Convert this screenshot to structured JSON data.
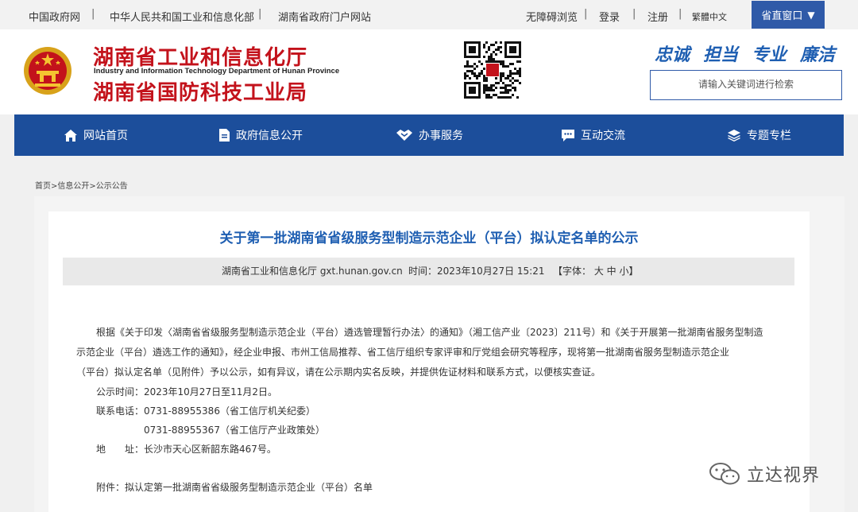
{
  "topbar": {
    "links": [
      "中国政府网",
      "中华人民共和国工业和信息化部",
      "湖南省政府门户网站"
    ],
    "accessibility": "无障碍浏览",
    "login": "登录",
    "register": "注册",
    "traditional": "繁體中文",
    "province_window": "省直窗口"
  },
  "header": {
    "org_name_1": "湖南省工业和信息化厅",
    "org_name_en": "Industry and Information Technology Department of Hunan Province",
    "org_name_2": "湖南省国防科技工业局",
    "slogans": [
      "忠诚",
      "担当",
      "专业",
      "廉洁"
    ],
    "search_placeholder": "请输入关键词进行检索"
  },
  "nav": {
    "items": [
      {
        "label": "网站首页",
        "icon": "home-icon"
      },
      {
        "label": "政府信息公开",
        "icon": "document-icon"
      },
      {
        "label": "办事服务",
        "icon": "handshake-icon"
      },
      {
        "label": "互动交流",
        "icon": "chat-icon"
      },
      {
        "label": "专题专栏",
        "icon": "layers-icon"
      }
    ]
  },
  "breadcrumb": "首页>信息公开>公示公告",
  "article": {
    "title": "关于第一批湖南省省级服务型制造示范企业（平台）拟认定名单的公示",
    "source": "湖南省工业和信息化厅 gxt.hunan.gov.cn",
    "time": "时间：2023年10月27日 15:21",
    "font_label": "【字体： 大 中 小】",
    "paragraph_lines": [
      "根据《关于印发〈湖南省省级服务型制造示范企业（平台）遴选管理暂行办法〉的通知》（湘工信产业〔2023〕211号）和《关于开展第一批湖南省服务型制造",
      "示范企业（平台）遴选工作的通知》，经企业申报、市州工信局推荐、省工信厅组织专家评审和厅党组会研究等程序，现将第一批湖南省服务型制造示范企业",
      "（平台）拟认定名单（见附件）予以公示，如有异议，请在公示期内实名反映，并提供佐证材料和联系方式，以便核实查证。"
    ],
    "period": "公示时间：2023年10月27日至11月2日。",
    "phone_1": "联系电话：0731-88955386（省工信厅机关纪委）",
    "phone_2": "0731-88955367（省工信厅产业政策处）",
    "address": "地　　址：长沙市天心区新韶东路467号。",
    "attachment": "附件：拟认定第一批湖南省省级服务型制造示范企业（平台）名单"
  },
  "watermark": "立达视界"
}
